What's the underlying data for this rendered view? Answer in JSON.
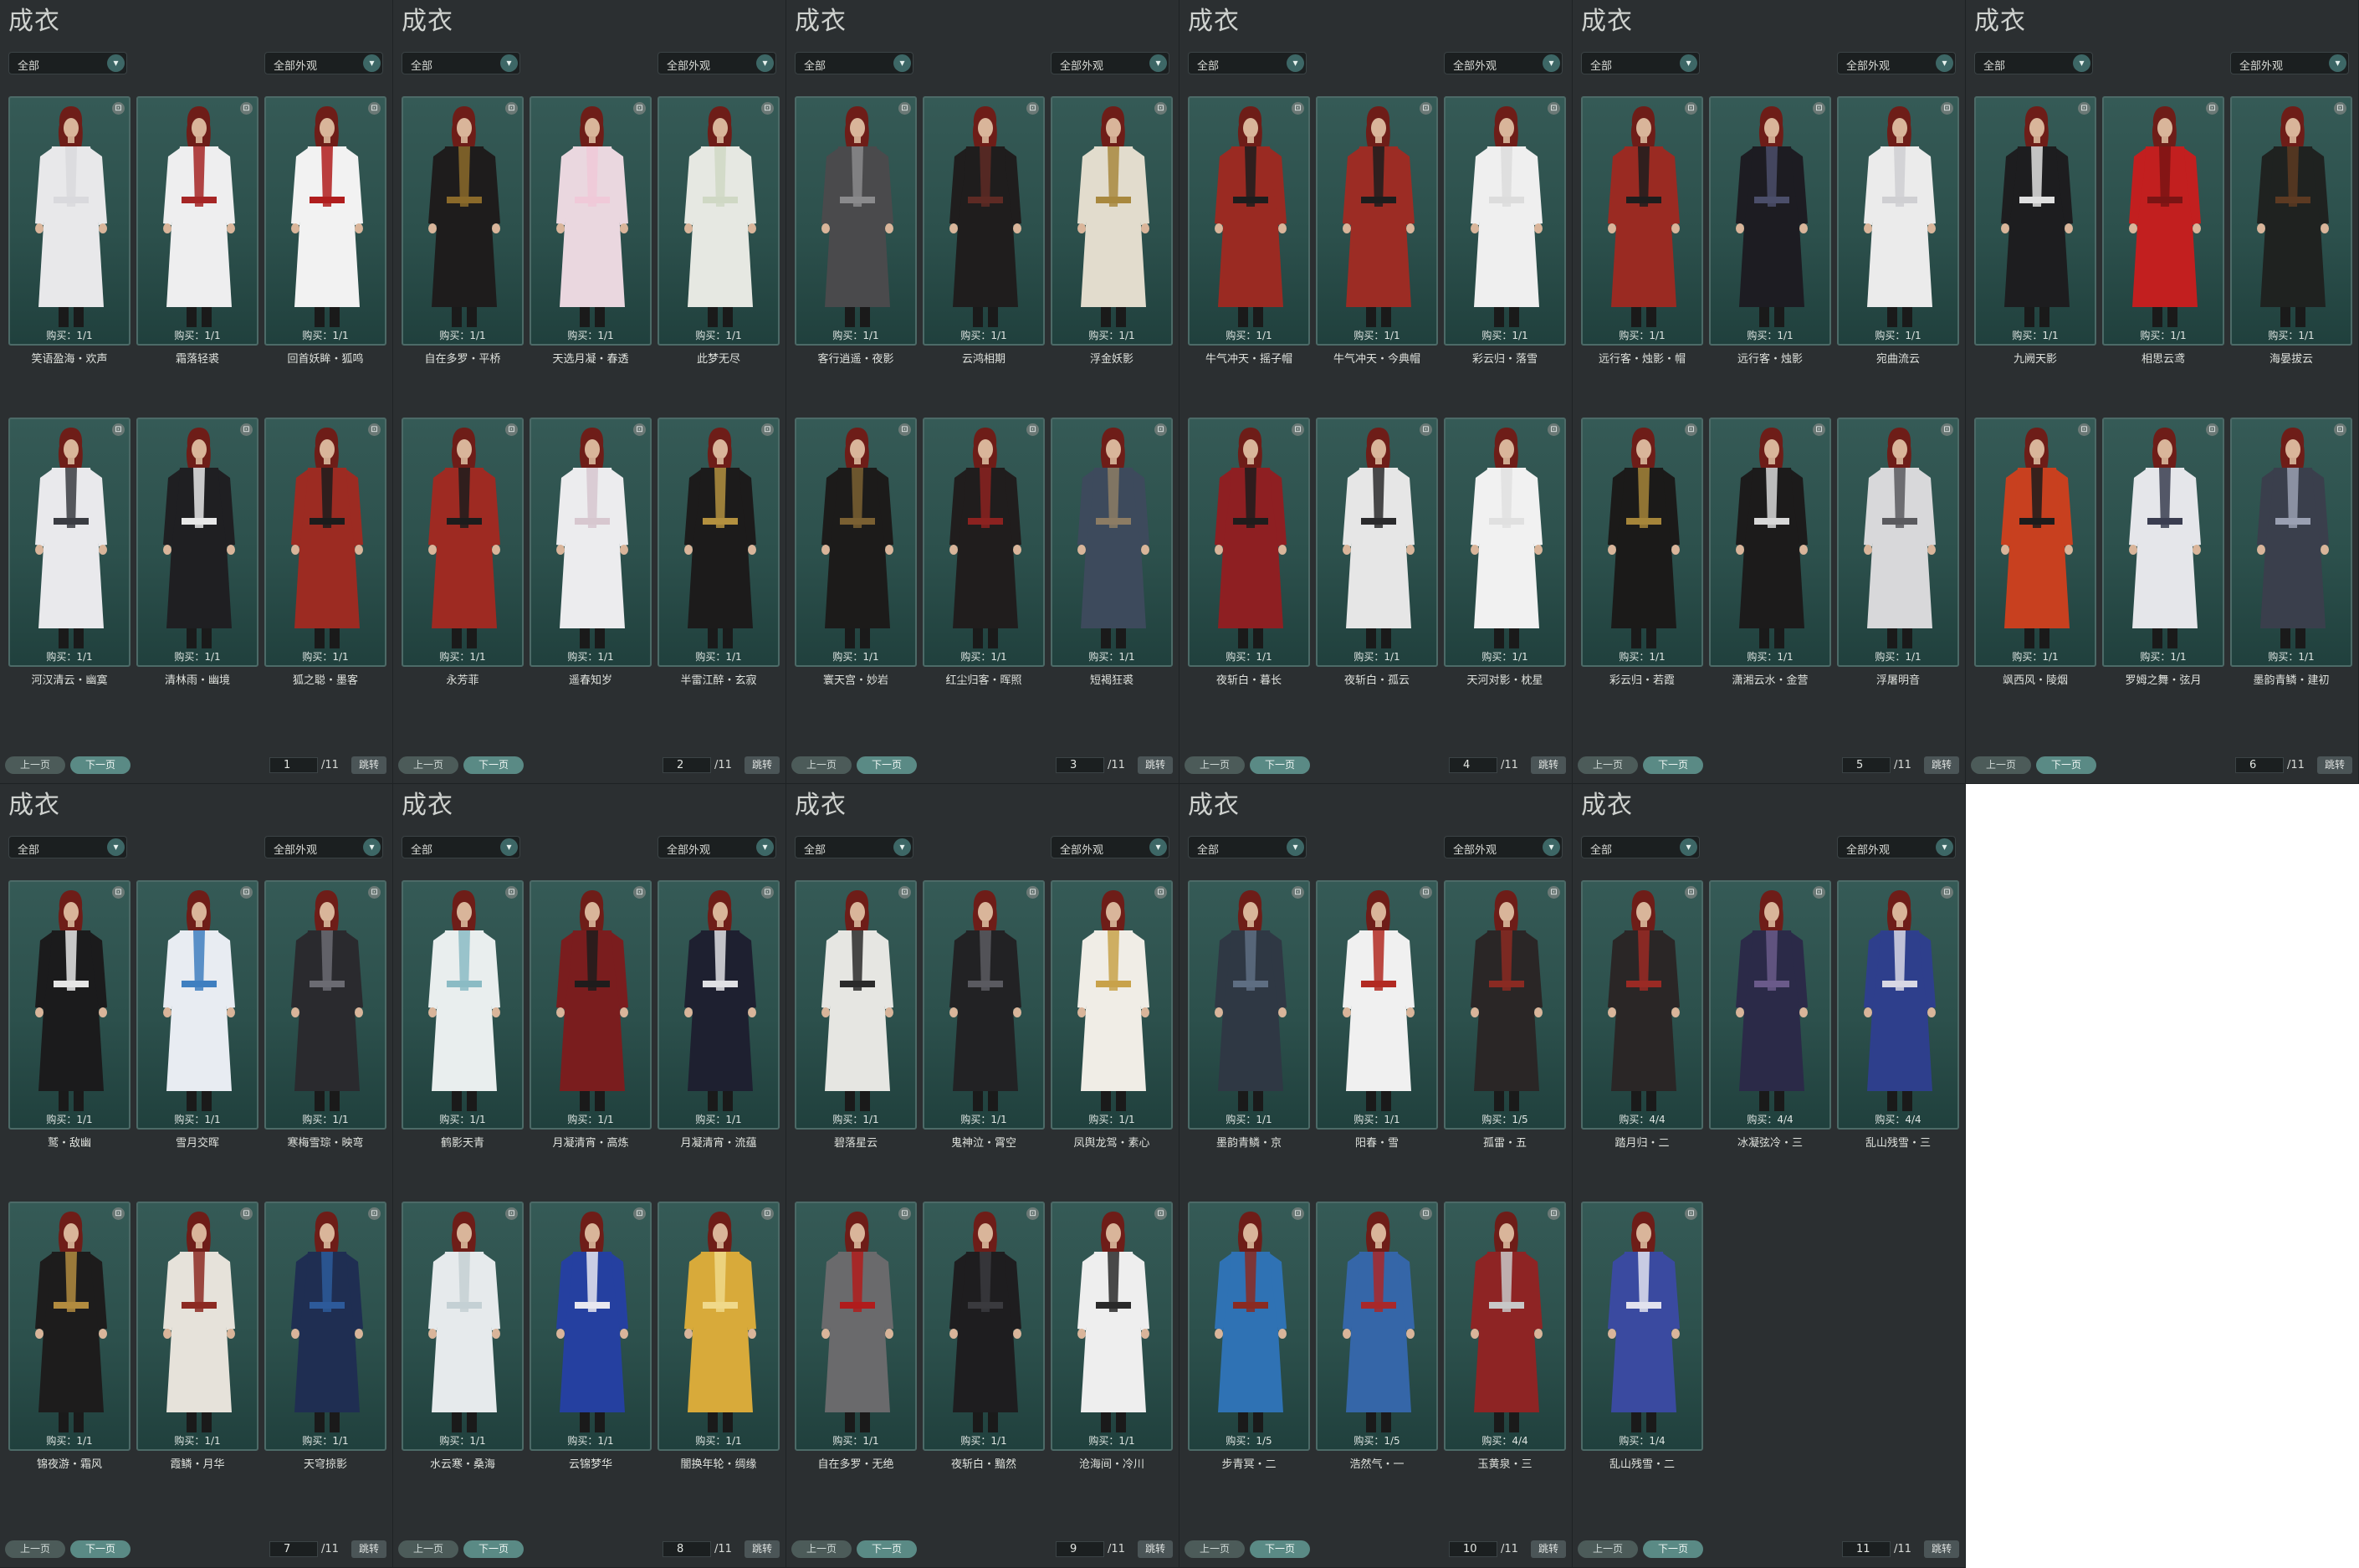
{
  "panels": [
    {
      "title": "成衣",
      "filter_left": "全部",
      "filter_right": "全部外观",
      "prev_label": "上一页",
      "next_label": "下一页",
      "page": "1",
      "total": "/11",
      "jump_label": "跳转",
      "items": [
        {
          "name": "笑语盈海・欢声",
          "buy": "购买：1/1",
          "robe": "#e8e8ea",
          "accent": "#d9d9dd"
        },
        {
          "name": "霜落轻裘",
          "buy": "购买：1/1",
          "robe": "#eeeeef",
          "accent": "#a52525"
        },
        {
          "name": "回首妖眸・狐鸣",
          "buy": "购买：1/1",
          "robe": "#f2f2f2",
          "accent": "#b01d1d"
        },
        {
          "name": "河汉清云・幽寞",
          "buy": "购买：1/1",
          "robe": "#e9e9ec",
          "accent": "#3a3c42"
        },
        {
          "name": "清林雨・幽境",
          "buy": "购买：1/1",
          "robe": "#1f1f22",
          "accent": "#e8e8e8"
        },
        {
          "name": "狐之聪・墨客",
          "buy": "购买：1/1",
          "robe": "#9c2b22",
          "accent": "#1c1c1c"
        }
      ]
    },
    {
      "title": "成衣",
      "filter_left": "全部",
      "filter_right": "全部外观",
      "prev_label": "上一页",
      "next_label": "下一页",
      "page": "2",
      "total": "/11",
      "jump_label": "跳转",
      "items": [
        {
          "name": "自在多罗・平桥",
          "buy": "购买：1/1",
          "robe": "#1e1c1c",
          "accent": "#8b6a2a"
        },
        {
          "name": "天选月凝・春透",
          "buy": "购买：1/1",
          "robe": "#ead7df",
          "accent": "#f0c9d8"
        },
        {
          "name": "此梦无尽",
          "buy": "购买：1/1",
          "robe": "#e6e8e2",
          "accent": "#cfd8c4"
        },
        {
          "name": "永芳菲",
          "buy": "购买：1/1",
          "robe": "#9e2a22",
          "accent": "#1c1c1c"
        },
        {
          "name": "遥春知岁",
          "buy": "购买：1/1",
          "robe": "#ececee",
          "accent": "#d7c7cf"
        },
        {
          "name": "半雷江醉・玄寂",
          "buy": "购买：1/1",
          "robe": "#1c1b1b",
          "accent": "#b3903f"
        }
      ]
    },
    {
      "title": "成衣",
      "filter_left": "全部",
      "filter_right": "全部外观",
      "prev_label": "上一页",
      "next_label": "下一页",
      "page": "3",
      "total": "/11",
      "jump_label": "跳转",
      "items": [
        {
          "name": "客行逍遥・夜影",
          "buy": "购买：1/1",
          "robe": "#4a4a4c",
          "accent": "#8a8a8c"
        },
        {
          "name": "云鸿相期",
          "buy": "购买：1/1",
          "robe": "#1f1d1d",
          "accent": "#5e2a24"
        },
        {
          "name": "浮金妖影",
          "buy": "购买：1/1",
          "robe": "#e2dccd",
          "accent": "#a8883e"
        },
        {
          "name": "寰天宫・妙岩",
          "buy": "购买：1/1",
          "robe": "#1c1b1a",
          "accent": "#7a6032"
        },
        {
          "name": "红尘归客・晖照",
          "buy": "购买：1/1",
          "robe": "#201d1d",
          "accent": "#8c2220"
        },
        {
          "name": "短褐狂裘",
          "buy": "购买：1/1",
          "robe": "#3d4a5c",
          "accent": "#8c7c64"
        }
      ]
    },
    {
      "title": "成衣",
      "filter_left": "全部",
      "filter_right": "全部外观",
      "prev_label": "上一页",
      "next_label": "下一页",
      "page": "4",
      "total": "/11",
      "jump_label": "跳转",
      "items": [
        {
          "name": "牛气冲天・摇子帽",
          "buy": "购买：1/1",
          "robe": "#9a2a22",
          "accent": "#1d1d1d"
        },
        {
          "name": "牛气冲天・今典帽",
          "buy": "购买：1/1",
          "robe": "#9c2c24",
          "accent": "#1d1d1d"
        },
        {
          "name": "彩云归・落雪",
          "buy": "购买：1/1",
          "robe": "#efefef",
          "accent": "#dcdcdc"
        },
        {
          "name": "夜斩白・暮长",
          "buy": "购买：1/1",
          "robe": "#8e1f22",
          "accent": "#1f1c1c"
        },
        {
          "name": "夜斩白・孤云",
          "buy": "购买：1/1",
          "robe": "#e6e6e6",
          "accent": "#2a2a2c"
        },
        {
          "name": "天河对影・枕星",
          "buy": "购买：1/1",
          "robe": "#f1f1f1",
          "accent": "#e0e0e0"
        }
      ]
    },
    {
      "title": "成衣",
      "filter_left": "全部",
      "filter_right": "全部外观",
      "prev_label": "上一页",
      "next_label": "下一页",
      "page": "5",
      "total": "/11",
      "jump_label": "跳转",
      "items": [
        {
          "name": "远行客・烛影・帽",
          "buy": "购买：1/1",
          "robe": "#9a2a22",
          "accent": "#1d1d1d"
        },
        {
          "name": "远行客・烛影",
          "buy": "购买：1/1",
          "robe": "#1d1c22",
          "accent": "#4b4e6a"
        },
        {
          "name": "宛曲流云",
          "buy": "购买：1/1",
          "robe": "#ebebeb",
          "accent": "#cfcfd2"
        },
        {
          "name": "彩云归・若霞",
          "buy": "购买：1/1",
          "robe": "#1b1a19",
          "accent": "#a5853a"
        },
        {
          "name": "潇湘云水・金营",
          "buy": "购买：1/1",
          "robe": "#1c1b1b",
          "accent": "#d8d8d8"
        },
        {
          "name": "浮屠明音",
          "buy": "购买：1/1",
          "robe": "#d8d8da",
          "accent": "#5a5a5e"
        }
      ]
    },
    {
      "title": "成衣",
      "filter_left": "全部",
      "filter_right": "全部外观",
      "prev_label": "上一页",
      "next_label": "下一页",
      "page": "6",
      "total": "/11",
      "jump_label": "跳转",
      "items": [
        {
          "name": "九阙天影",
          "buy": "购买：1/1",
          "robe": "#1d1d1f",
          "accent": "#e0e0e0"
        },
        {
          "name": "相思云鸢",
          "buy": "购买：1/1",
          "robe": "#c21f1f",
          "accent": "#7a1414"
        },
        {
          "name": "海晏拔云",
          "buy": "购买：1/1",
          "robe": "#1f2220",
          "accent": "#5c3a22"
        },
        {
          "name": "飒西风・陵烟",
          "buy": "购买：1/1",
          "robe": "#c8401f",
          "accent": "#1c1c1c"
        },
        {
          "name": "罗姆之舞・弦月",
          "buy": "购买：1/1",
          "robe": "#e5e6ea",
          "accent": "#3a3d50"
        },
        {
          "name": "墨韵青鳞・建初",
          "buy": "购买：1/1",
          "robe": "#3a3f4c",
          "accent": "#9aa0b2"
        }
      ]
    },
    {
      "title": "成衣",
      "filter_left": "全部",
      "filter_right": "全部外观",
      "prev_label": "上一页",
      "next_label": "下一页",
      "page": "7",
      "total": "/11",
      "jump_label": "跳转",
      "items": [
        {
          "name": "鹫・敌幽",
          "buy": "购买：1/1",
          "robe": "#1b1b1c",
          "accent": "#e6e6e6"
        },
        {
          "name": "雪月交晖",
          "buy": "购买：1/1",
          "robe": "#e8ecf2",
          "accent": "#3f7fc0"
        },
        {
          "name": "寒梅雪琮・映弯",
          "buy": "购买：1/1",
          "robe": "#2a2a2e",
          "accent": "#6b6b72"
        },
        {
          "name": "锦夜游・霜风",
          "buy": "购买：1/1",
          "robe": "#1d1c1c",
          "accent": "#b28b3f"
        },
        {
          "name": "霞鳞・月华",
          "buy": "购买：1/1",
          "robe": "#e6e2da",
          "accent": "#8c2a22"
        },
        {
          "name": "天穹掠影",
          "buy": "购买：1/1",
          "robe": "#1f2e52",
          "accent": "#2d5a9a"
        }
      ]
    },
    {
      "title": "成衣",
      "filter_left": "全部",
      "filter_right": "全部外观",
      "prev_label": "上一页",
      "next_label": "下一页",
      "page": "8",
      "total": "/11",
      "jump_label": "跳转",
      "items": [
        {
          "name": "鹤影天青",
          "buy": "购买：1/1",
          "robe": "#e9eeee",
          "accent": "#8bbbc4"
        },
        {
          "name": "月凝清宵・高炼",
          "buy": "购买：1/1",
          "robe": "#7a1d1e",
          "accent": "#1f1c1c"
        },
        {
          "name": "月凝清宵・流蕴",
          "buy": "购买：1/1",
          "robe": "#1e2030",
          "accent": "#e0e0e4"
        },
        {
          "name": "水云寒・桑海",
          "buy": "购买：1/1",
          "robe": "#e6eaec",
          "accent": "#c4d0d4"
        },
        {
          "name": "云锦梦华",
          "buy": "购买：1/1",
          "robe": "#2540a0",
          "accent": "#e8e8f0"
        },
        {
          "name": "闇换年轮・绸缘",
          "buy": "购买：1/1",
          "robe": "#d8aa3a",
          "accent": "#f0d98a"
        }
      ]
    },
    {
      "title": "成衣",
      "filter_left": "全部",
      "filter_right": "全部外观",
      "prev_label": "上一页",
      "next_label": "下一页",
      "page": "9",
      "total": "/11",
      "jump_label": "跳转",
      "items": [
        {
          "name": "碧落星云",
          "buy": "购买：1/1",
          "robe": "#e6e6e2",
          "accent": "#2a2a2a"
        },
        {
          "name": "鬼神泣・霄空",
          "buy": "购买：1/1",
          "robe": "#222224",
          "accent": "#5a5a60"
        },
        {
          "name": "凤舆龙驾・素心",
          "buy": "购买：1/1",
          "robe": "#f0ede6",
          "accent": "#c8a24a"
        },
        {
          "name": "自在多罗・无绝",
          "buy": "购买：1/1",
          "robe": "#6a6a6c",
          "accent": "#b01c1c"
        },
        {
          "name": "夜斩白・黯然",
          "buy": "购买：1/1",
          "robe": "#1e1d1f",
          "accent": "#3a3a3e"
        },
        {
          "name": "沧海间・冷川",
          "buy": "购买：1/1",
          "robe": "#eeeeee",
          "accent": "#2a2a2a"
        }
      ]
    },
    {
      "title": "成衣",
      "filter_left": "全部",
      "filter_right": "全部外观",
      "prev_label": "上一页",
      "next_label": "下一页",
      "page": "10",
      "total": "/11",
      "jump_label": "跳转",
      "items": [
        {
          "name": "墨韵青鳞・京",
          "buy": "购买：1/1",
          "robe": "#2f3844",
          "accent": "#5e6e82"
        },
        {
          "name": "阳春・雪",
          "buy": "购买：1/1",
          "robe": "#f0f0f0",
          "accent": "#b22a22"
        },
        {
          "name": "孤雷・五",
          "buy": "购买：1/5",
          "robe": "#2a2626",
          "accent": "#8a2a22"
        },
        {
          "name": "步青冥・二",
          "buy": "购买：1/5",
          "robe": "#2f72b4",
          "accent": "#8a2a22"
        },
        {
          "name": "浩然气・一",
          "buy": "购买：1/5",
          "robe": "#3566a8",
          "accent": "#a8282a"
        },
        {
          "name": "玉黄泉・三",
          "buy": "购买：4/4",
          "robe": "#8e2424",
          "accent": "#c8c8c8"
        }
      ]
    },
    {
      "title": "成衣",
      "filter_left": "全部",
      "filter_right": "全部外观",
      "prev_label": "上一页",
      "next_label": "下一页",
      "page": "11",
      "total": "/11",
      "jump_label": "跳转",
      "items": [
        {
          "name": "踏月归・二",
          "buy": "购买：4/4",
          "robe": "#2a2626",
          "accent": "#9a2a24"
        },
        {
          "name": "冰凝弦冷・三",
          "buy": "购买：4/4",
          "robe": "#2b2a48",
          "accent": "#6a5a8a"
        },
        {
          "name": "乱山残雪・三",
          "buy": "购买：4/4",
          "robe": "#2e3f8c",
          "accent": "#d8d8e4"
        },
        {
          "name": "乱山残雪・二",
          "buy": "购买：1/4",
          "robe": "#3a4aa0",
          "accent": "#e2e2ee"
        }
      ]
    }
  ]
}
